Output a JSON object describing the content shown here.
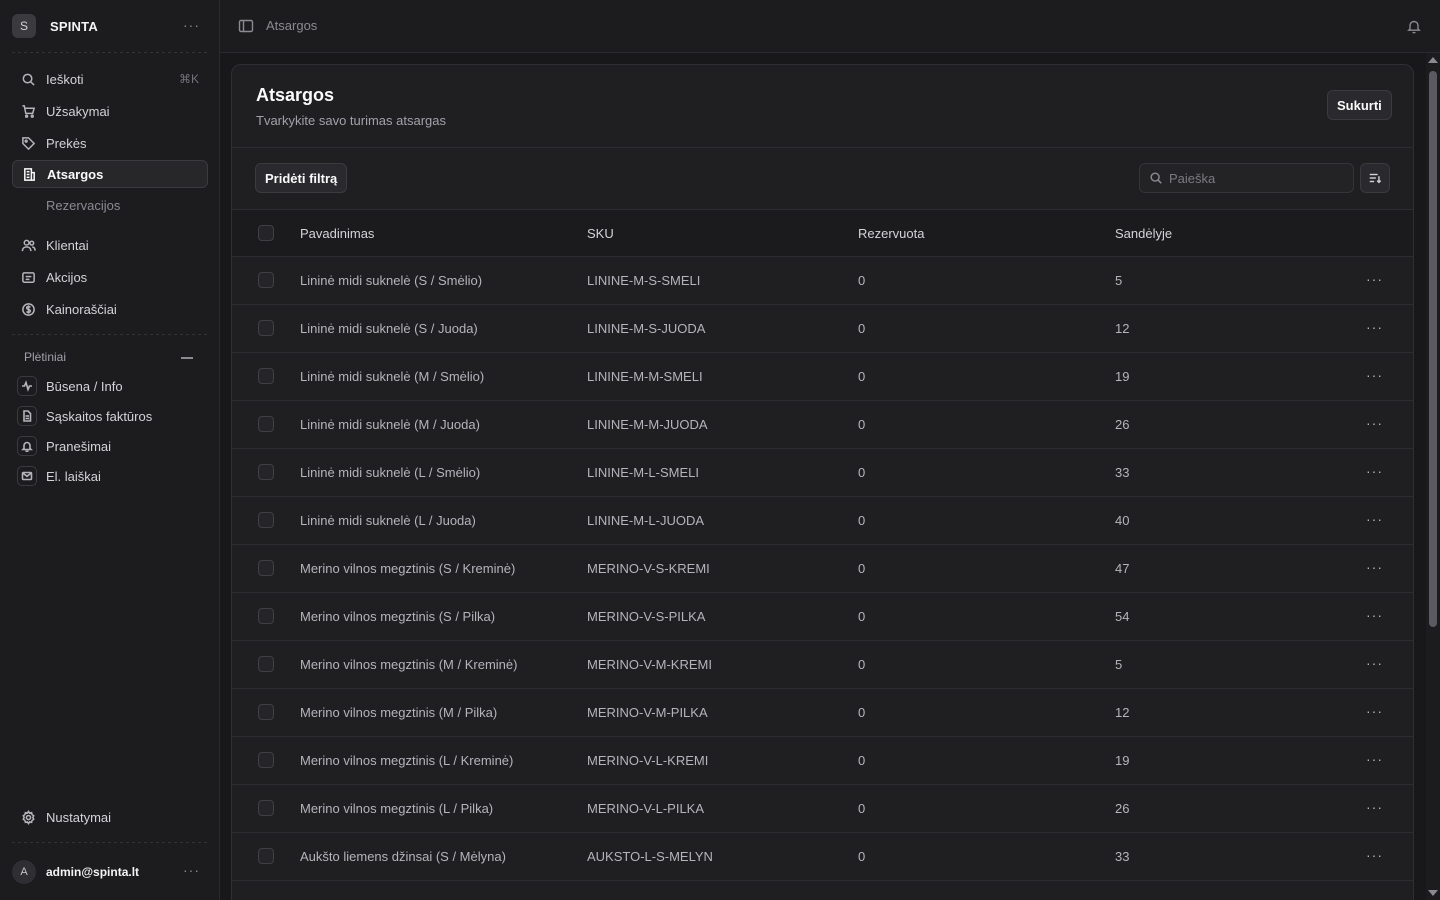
{
  "brand": {
    "initial": "S",
    "name": "SPINTA"
  },
  "sidebar": {
    "search_label": "Ieškoti",
    "search_shortcut": "⌘K",
    "items": [
      {
        "label": "Užsakymai",
        "icon": "cart-icon"
      },
      {
        "label": "Prekės",
        "icon": "tag-icon"
      },
      {
        "label": "Atsargos",
        "icon": "building-icon",
        "active": true
      },
      {
        "label": "Klientai",
        "icon": "users-icon"
      },
      {
        "label": "Akcijos",
        "icon": "receipt-icon"
      },
      {
        "label": "Kainoraščiai",
        "icon": "dollar-icon"
      }
    ],
    "sub_item": "Rezervacijos",
    "extensions_label": "Plėtiniai",
    "extensions": [
      {
        "label": "Būsena / Info",
        "icon": "pulse-icon"
      },
      {
        "label": "Sąskaitos faktūros",
        "icon": "document-icon"
      },
      {
        "label": "Pranešimai",
        "icon": "bell-icon"
      },
      {
        "label": "El. laiškai",
        "icon": "mail-icon"
      }
    ],
    "settings_label": "Nustatymai",
    "user": {
      "initial": "A",
      "email": "admin@spinta.lt"
    }
  },
  "topbar": {
    "breadcrumb": "Atsargos"
  },
  "page": {
    "title": "Atsargos",
    "subtitle": "Tvarkykite savo turimas atsargas",
    "create_label": "Sukurti",
    "filter_label": "Pridėti filtrą",
    "search_placeholder": "Paieška"
  },
  "table": {
    "columns": [
      "Pavadinimas",
      "SKU",
      "Rezervuota",
      "Sandėlyje"
    ],
    "rows": [
      {
        "name": "Lininė midi suknelė (S / Smėlio)",
        "sku": "LININE-M-S-SMELI",
        "reserved": "0",
        "stock": "5"
      },
      {
        "name": "Lininė midi suknelė (S / Juoda)",
        "sku": "LININE-M-S-JUODA",
        "reserved": "0",
        "stock": "12"
      },
      {
        "name": "Lininė midi suknelė (M / Smėlio)",
        "sku": "LININE-M-M-SMELI",
        "reserved": "0",
        "stock": "19"
      },
      {
        "name": "Lininė midi suknelė (M / Juoda)",
        "sku": "LININE-M-M-JUODA",
        "reserved": "0",
        "stock": "26"
      },
      {
        "name": "Lininė midi suknelė (L / Smėlio)",
        "sku": "LININE-M-L-SMELI",
        "reserved": "0",
        "stock": "33"
      },
      {
        "name": "Lininė midi suknelė (L / Juoda)",
        "sku": "LININE-M-L-JUODA",
        "reserved": "0",
        "stock": "40"
      },
      {
        "name": "Merino vilnos megztinis (S / Kreminė)",
        "sku": "MERINO-V-S-KREMI",
        "reserved": "0",
        "stock": "47"
      },
      {
        "name": "Merino vilnos megztinis (S / Pilka)",
        "sku": "MERINO-V-S-PILKA",
        "reserved": "0",
        "stock": "54"
      },
      {
        "name": "Merino vilnos megztinis (M / Kreminė)",
        "sku": "MERINO-V-M-KREMI",
        "reserved": "0",
        "stock": "5"
      },
      {
        "name": "Merino vilnos megztinis (M / Pilka)",
        "sku": "MERINO-V-M-PILKA",
        "reserved": "0",
        "stock": "12"
      },
      {
        "name": "Merino vilnos megztinis (L / Kreminė)",
        "sku": "MERINO-V-L-KREMI",
        "reserved": "0",
        "stock": "19"
      },
      {
        "name": "Merino vilnos megztinis (L / Pilka)",
        "sku": "MERINO-V-L-PILKA",
        "reserved": "0",
        "stock": "26"
      },
      {
        "name": "Aukšto liemens džinsai (S / Mėlyna)",
        "sku": "AUKSTO-L-S-MELYN",
        "reserved": "0",
        "stock": "33"
      }
    ]
  },
  "colors": {
    "background": "#18181b",
    "surface": "#1f1f22",
    "border": "#2c2c31",
    "text": "#e4e4e7",
    "muted": "#a1a1aa"
  }
}
